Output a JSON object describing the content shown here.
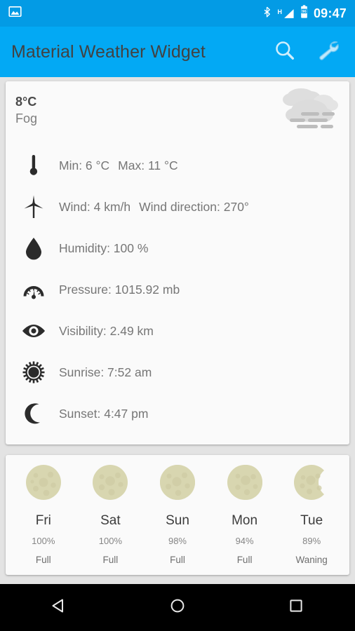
{
  "status_bar": {
    "left_icons": [
      {
        "name": "image-icon",
        "label": "image"
      }
    ],
    "right_icons": [
      {
        "name": "bluetooth-icon",
        "label": "bluetooth"
      },
      {
        "name": "signal-hspa-icon",
        "label": "H"
      },
      {
        "name": "battery-icon",
        "label": "96"
      }
    ],
    "battery_level": "96",
    "network_type": "H",
    "clock": "09:47",
    "background_color": "#039BE5"
  },
  "toolbar": {
    "title": "Material Weather Widget",
    "background_color": "#03A9F4",
    "title_color": "#424242",
    "actions": [
      {
        "name": "search-button",
        "label": "Search"
      },
      {
        "name": "settings-button",
        "label": "Settings"
      }
    ]
  },
  "current": {
    "temperature": "8°C",
    "condition": "Fog",
    "weather_icon": "fog-icon",
    "details": [
      {
        "icon": "thermometer-icon",
        "primary": "Min: 6 °C",
        "secondary": "Max: 11 °C"
      },
      {
        "icon": "wind-turbine-icon",
        "primary": "Wind: 4 km/h",
        "secondary": "Wind direction: 270°"
      },
      {
        "icon": "water-drop-icon",
        "primary": "Humidity: 100 %",
        "secondary": ""
      },
      {
        "icon": "gauge-icon",
        "primary": "Pressure: 1015.92 mb",
        "secondary": ""
      },
      {
        "icon": "eye-icon",
        "primary": "Visibility: 2.49 km",
        "secondary": ""
      },
      {
        "icon": "sun-icon",
        "primary": "Sunrise: 7:52 am",
        "secondary": ""
      },
      {
        "icon": "moon-icon",
        "primary": "Sunset: 4:47 pm",
        "secondary": ""
      }
    ]
  },
  "moon_forecast": {
    "days": [
      {
        "day": "Fri",
        "percent": "100%",
        "phase": "Full",
        "illumination": 100
      },
      {
        "day": "Sat",
        "percent": "100%",
        "phase": "Full",
        "illumination": 100
      },
      {
        "day": "Sun",
        "percent": "98%",
        "phase": "Full",
        "illumination": 98
      },
      {
        "day": "Mon",
        "percent": "94%",
        "phase": "Full",
        "illumination": 94
      },
      {
        "day": "Tue",
        "percent": "89%",
        "phase": "Waning",
        "illumination": 89
      }
    ],
    "moon_color": "#d8d6b0"
  },
  "nav_bar": {
    "buttons": [
      {
        "name": "back-button",
        "label": "Back"
      },
      {
        "name": "home-button",
        "label": "Home"
      },
      {
        "name": "recents-button",
        "label": "Recents"
      }
    ],
    "background_color": "#000000"
  },
  "colors": {
    "accent": "#03A9F4",
    "status_bar": "#039BE5",
    "page_background": "#e3e3e3",
    "card_background": "#fafafa"
  }
}
